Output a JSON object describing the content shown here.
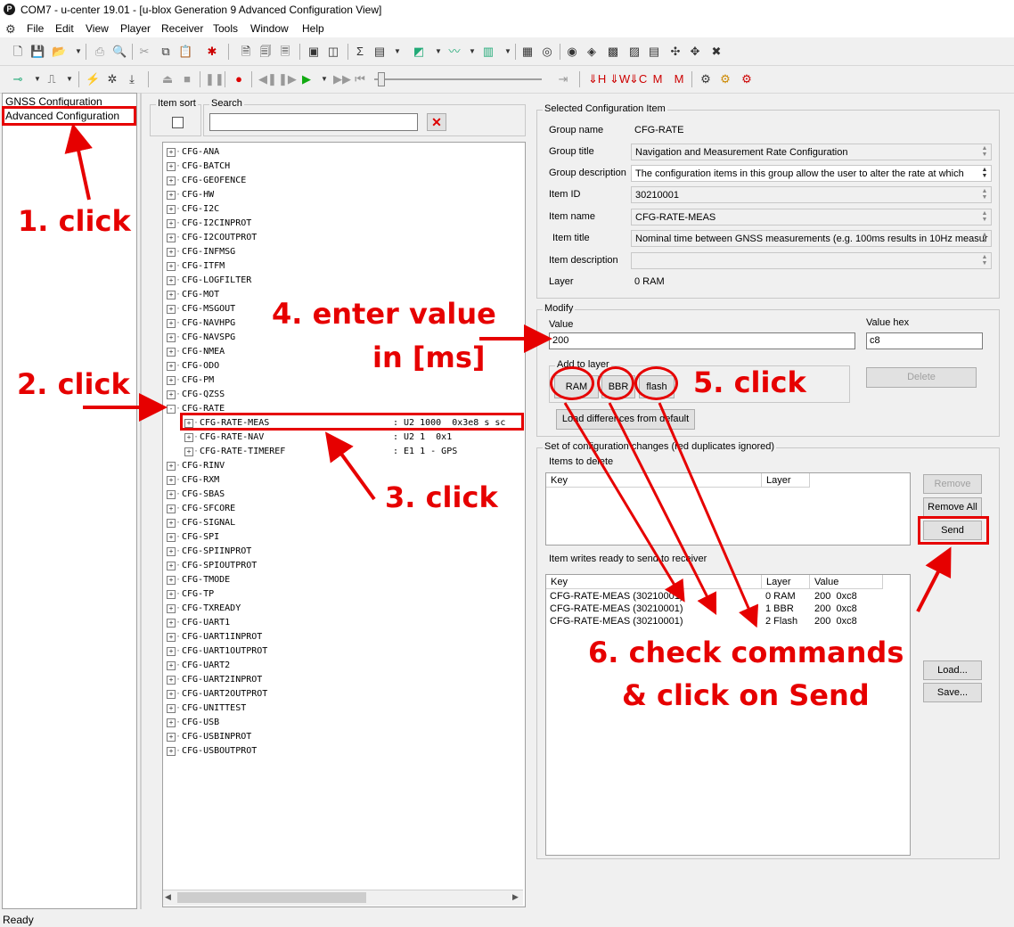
{
  "window": {
    "title": "COM7 - u-center 19.01 - [u-blox Generation 9 Advanced Configuration View]",
    "app_icon_letter": "P"
  },
  "menu": [
    "File",
    "Edit",
    "View",
    "Player",
    "Receiver",
    "Tools",
    "Window",
    "Help"
  ],
  "left_nav": {
    "items": [
      "GNSS Configuration",
      "Advanced Configuration"
    ],
    "selected": "Advanced Configuration"
  },
  "item_sort": {
    "label": "Item sort"
  },
  "search": {
    "label": "Search",
    "value": ""
  },
  "tree": {
    "items": [
      {
        "name": "CFG-ANA",
        "expander": "+"
      },
      {
        "name": "CFG-BATCH",
        "expander": "+"
      },
      {
        "name": "CFG-GEOFENCE",
        "expander": "+"
      },
      {
        "name": "CFG-HW",
        "expander": "+"
      },
      {
        "name": "CFG-I2C",
        "expander": "+"
      },
      {
        "name": "CFG-I2CINPROT",
        "expander": "+"
      },
      {
        "name": "CFG-I2COUTPROT",
        "expander": "+"
      },
      {
        "name": "CFG-INFMSG",
        "expander": "+"
      },
      {
        "name": "CFG-ITFM",
        "expander": "+"
      },
      {
        "name": "CFG-LOGFILTER",
        "expander": "+"
      },
      {
        "name": "CFG-MOT",
        "expander": "+"
      },
      {
        "name": "CFG-MSGOUT",
        "expander": "+"
      },
      {
        "name": "CFG-NAVHPG",
        "expander": "+"
      },
      {
        "name": "CFG-NAVSPG",
        "expander": "+"
      },
      {
        "name": "CFG-NMEA",
        "expander": "+"
      },
      {
        "name": "CFG-ODO",
        "expander": "+"
      },
      {
        "name": "CFG-PM",
        "expander": "+"
      },
      {
        "name": "CFG-QZSS",
        "expander": "+"
      },
      {
        "name": "CFG-RATE",
        "expander": "-"
      },
      {
        "name": "CFG-RATE-MEAS",
        "expander": "+",
        "child": true,
        "info": ": U2 1000  0x3e8 s sc"
      },
      {
        "name": "CFG-RATE-NAV",
        "expander": "+",
        "child": true,
        "info": ": U2 1  0x1"
      },
      {
        "name": "CFG-RATE-TIMEREF",
        "expander": "+",
        "child": true,
        "info": ": E1 1 - GPS"
      },
      {
        "name": "CFG-RINV",
        "expander": "+"
      },
      {
        "name": "CFG-RXM",
        "expander": "+"
      },
      {
        "name": "CFG-SBAS",
        "expander": "+"
      },
      {
        "name": "CFG-SFCORE",
        "expander": "+"
      },
      {
        "name": "CFG-SIGNAL",
        "expander": "+"
      },
      {
        "name": "CFG-SPI",
        "expander": "+"
      },
      {
        "name": "CFG-SPIINPROT",
        "expander": "+"
      },
      {
        "name": "CFG-SPIOUTPROT",
        "expander": "+"
      },
      {
        "name": "CFG-TMODE",
        "expander": "+"
      },
      {
        "name": "CFG-TP",
        "expander": "+"
      },
      {
        "name": "CFG-TXREADY",
        "expander": "+"
      },
      {
        "name": "CFG-UART1",
        "expander": "+"
      },
      {
        "name": "CFG-UART1INPROT",
        "expander": "+"
      },
      {
        "name": "CFG-UART1OUTPROT",
        "expander": "+"
      },
      {
        "name": "CFG-UART2",
        "expander": "+"
      },
      {
        "name": "CFG-UART2INPROT",
        "expander": "+"
      },
      {
        "name": "CFG-UART2OUTPROT",
        "expander": "+"
      },
      {
        "name": "CFG-UNITTEST",
        "expander": "+"
      },
      {
        "name": "CFG-USB",
        "expander": "+"
      },
      {
        "name": "CFG-USBINPROT",
        "expander": "+"
      },
      {
        "name": "CFG-USBOUTPROT",
        "expander": "+"
      }
    ]
  },
  "selected_item": {
    "section": "Selected Configuration Item",
    "fields": {
      "group_name": {
        "label": "Group name",
        "value": "CFG-RATE"
      },
      "group_title": {
        "label": "Group title",
        "value": "Navigation and Measurement Rate Configuration"
      },
      "group_description": {
        "label": "Group description",
        "value": "The configuration items in this group allow the user to alter the rate at which"
      },
      "item_id": {
        "label": "Item ID",
        "value": "30210001"
      },
      "item_name": {
        "label": "Item name",
        "value": "CFG-RATE-MEAS"
      },
      "item_title": {
        "label": "Item title",
        "value": "Nominal time between GNSS measurements (e.g. 100ms results in 10Hz measur"
      },
      "item_description": {
        "label": "Item description",
        "value": ""
      },
      "layer": {
        "label": "Layer",
        "value": "0 RAM"
      }
    }
  },
  "modify": {
    "section": "Modify",
    "value_label": "Value",
    "value": "200",
    "value_hex_label": "Value hex",
    "value_hex": "c8",
    "add_to_layer_label": "Add to layer",
    "layer_buttons": [
      "RAM",
      "BBR",
      "flash"
    ],
    "delete_button": "Delete",
    "load_diff_button": "Load differences from default"
  },
  "changes": {
    "section": "Set of configuration changes (red duplicates ignored)",
    "items_to_delete_label": "Items to delete",
    "delete_columns": [
      "Key",
      "Layer"
    ],
    "remove_button": "Remove",
    "remove_all_button": "Remove All",
    "send_button": "Send",
    "writes_label": "Item writes ready to send to receiver",
    "write_columns": [
      "Key",
      "Layer",
      "Value"
    ],
    "writes": [
      {
        "key": "CFG-RATE-MEAS (30210001)",
        "layer": "0 RAM",
        "value": "200  0xc8"
      },
      {
        "key": "CFG-RATE-MEAS (30210001)",
        "layer": "1 BBR",
        "value": "200  0xc8"
      },
      {
        "key": "CFG-RATE-MEAS (30210001)",
        "layer": "2 Flash",
        "value": "200  0xc8"
      }
    ],
    "load_button": "Load...",
    "save_button": "Save..."
  },
  "status": "Ready",
  "annotations": {
    "step1": "1. click",
    "step2": "2. click",
    "step3": "3. click",
    "step4_line1": "4. enter value",
    "step4_line2": "in [ms]",
    "step5": "5. click",
    "step6_line1": "6. check commands",
    "step6_line2": "& click on Send",
    "color": "#e60000"
  }
}
